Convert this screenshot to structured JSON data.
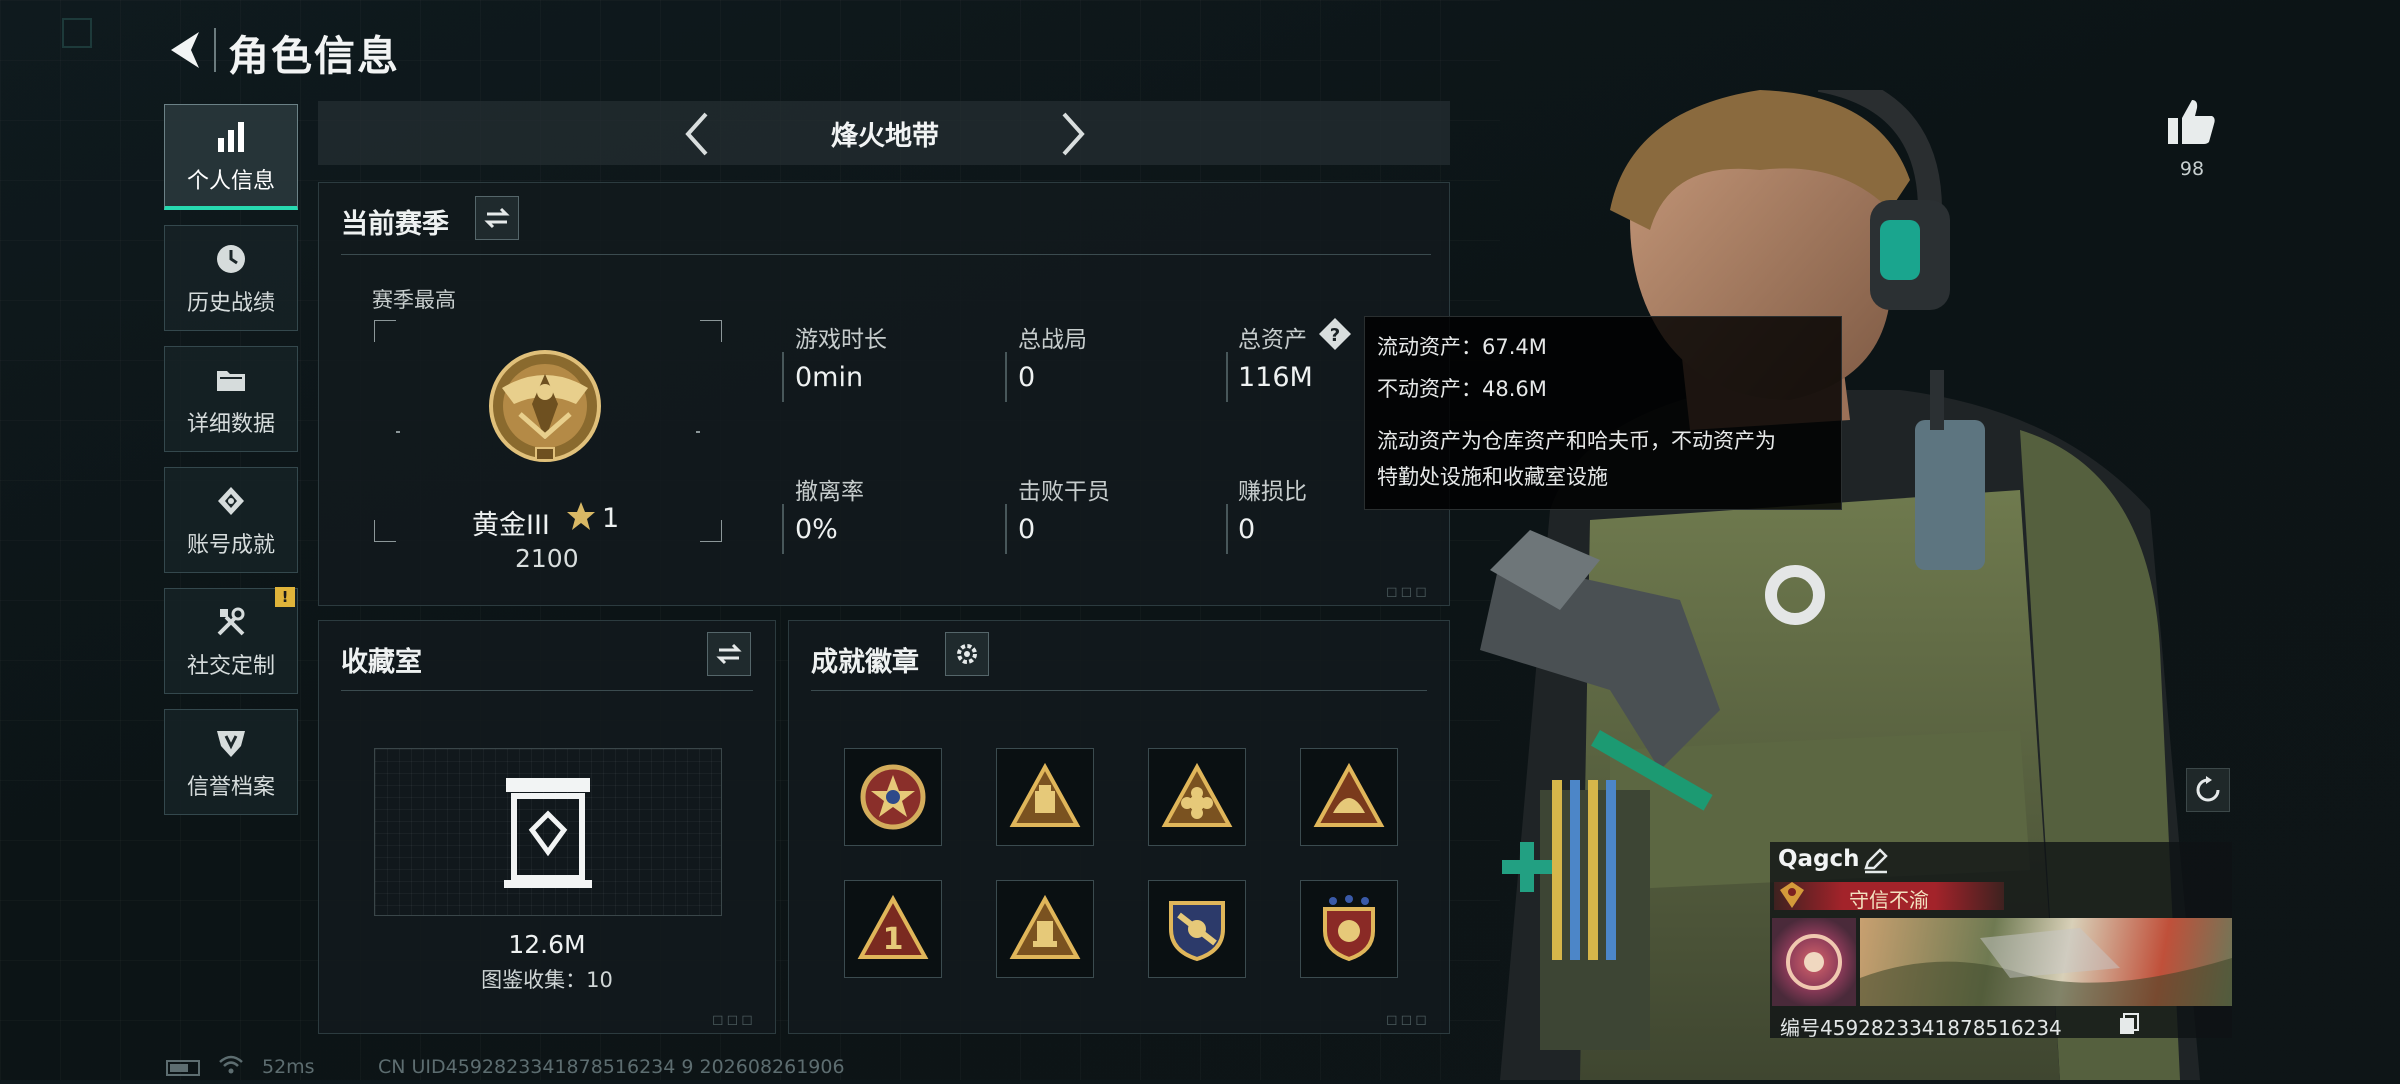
{
  "header": {
    "title": "角色信息"
  },
  "sidebar": {
    "items": [
      {
        "label": "个人信息",
        "icon": "bar-chart-icon",
        "active": true
      },
      {
        "label": "历史战绩",
        "icon": "history-clock-icon"
      },
      {
        "label": "详细数据",
        "icon": "folder-icon"
      },
      {
        "label": "账号成就",
        "icon": "achievement-icon"
      },
      {
        "label": "社交定制",
        "icon": "tools-icon",
        "badge": "!"
      },
      {
        "label": "信誉档案",
        "icon": "credit-shield-icon"
      }
    ]
  },
  "mode_selector": {
    "label": "烽火地带"
  },
  "season": {
    "title": "当前赛季",
    "peak_label": "赛季最高",
    "rank_name": "黄金III",
    "rank_stars": "1",
    "rank_score": "2100",
    "stats": [
      {
        "label": "游戏时长",
        "value": "0min"
      },
      {
        "label": "总战局",
        "value": "0"
      },
      {
        "label": "总资产",
        "value": "116M"
      },
      {
        "label": "撤离率",
        "value": "0%"
      },
      {
        "label": "击败干员",
        "value": "0"
      },
      {
        "label": "赚损比",
        "value": "0"
      }
    ]
  },
  "tooltip": {
    "liquid": "流动资产：67.4M",
    "fixed": "不动资产：48.6M",
    "desc_line1": "流动资产为仓库资产和哈夫币，不动资产为",
    "desc_line2": "特勤处设施和收藏室设施"
  },
  "collection": {
    "title": "收藏室",
    "value": "12.6M",
    "catalog": "图鉴收集：10"
  },
  "achievements": {
    "title": "成就徽章"
  },
  "likes": {
    "count": "98"
  },
  "player": {
    "name": "Qagch",
    "title_badge": "守信不渝",
    "id_text": "编号4592823341878516234"
  },
  "footer": {
    "ping": "52ms",
    "uid": "CN UID4592823341878516234 9 202608261906"
  },
  "colors": {
    "accent": "#27d9b0",
    "warning": "#e0b43a",
    "title_badge_bg": "#a3232a",
    "gold": "#c9a057"
  }
}
